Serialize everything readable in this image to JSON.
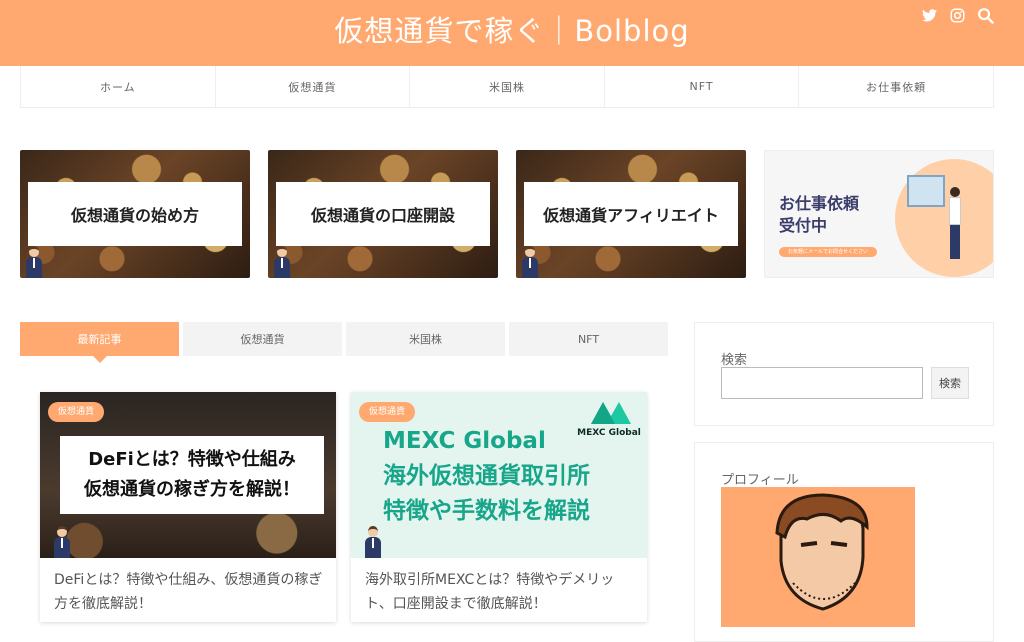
{
  "header": {
    "title": "仮想通貨で稼ぐ｜Bolblog",
    "icons": [
      "twitter-icon",
      "instagram-icon",
      "search-icon"
    ]
  },
  "nav": [
    "ホーム",
    "仮想通貨",
    "米国株",
    "NFT",
    "お仕事依頼"
  ],
  "banners": [
    {
      "label": "仮想通貨の始め方"
    },
    {
      "label": "仮想通貨の口座開設"
    },
    {
      "label": "仮想通貨アフィリエイト"
    }
  ],
  "work_banner": {
    "title": "お仕事依頼\n受付中",
    "pill": "お気軽にメールでお問合せください"
  },
  "tabs": [
    "最新記事",
    "仮想通貨",
    "米国株",
    "NFT"
  ],
  "cards": [
    {
      "badge": "仮想通貨",
      "image_text": "DeFiとは？特徴や仕組み\n仮想通貨の稼ぎ方を解説！",
      "title": "DeFiとは？特徴や仕組み、仮想通貨の稼ぎ方を徹底解説！"
    },
    {
      "badge": "仮想通貨",
      "image_text": "MEXC Global\n海外仮想通貨取引所\n特徴や手数料を解説",
      "logo_text": "MEXC Global",
      "title": "海外取引所MEXCとは？特徴やデメリット、口座開設まで徹底解説！"
    }
  ],
  "sidebar": {
    "search_title": "検索",
    "search_button": "検索",
    "search_value": "",
    "profile_title": "プロフィール"
  },
  "colors": {
    "accent": "#ffa970",
    "mexc_green": "#17a68a"
  }
}
